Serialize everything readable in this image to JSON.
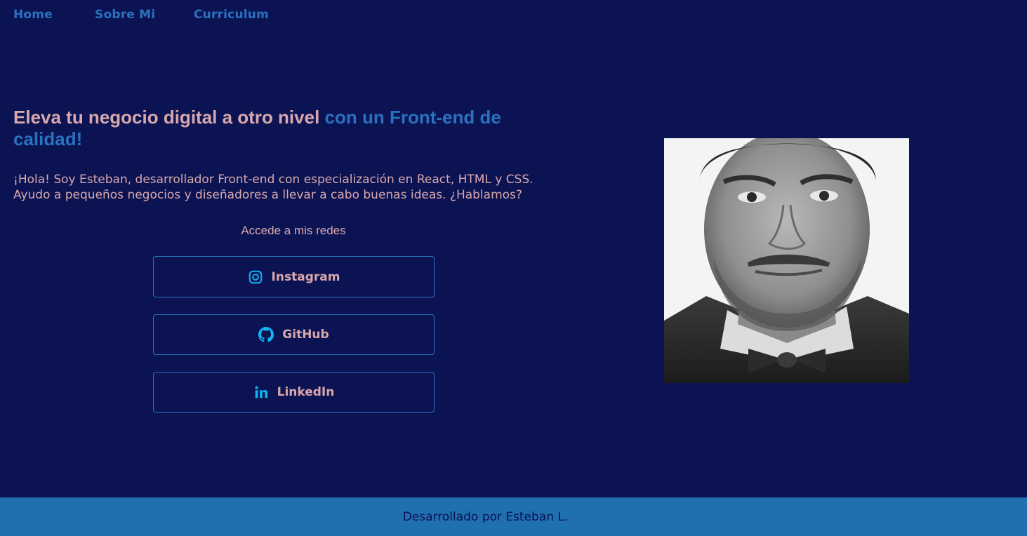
{
  "nav": {
    "items": [
      {
        "label": "Home"
      },
      {
        "label": "Sobre Mi"
      },
      {
        "label": "Curriculum"
      }
    ]
  },
  "hero": {
    "headline_part1": "Eleva tu negocio digital a otro nivel",
    "headline_part2": "con un Front-end de calidad!",
    "intro_line1": "¡Hola! Soy Esteban, desarrollador Front-end con especialización en React, HTML y CSS.",
    "intro_line2": "Ayudo a pequeños negocios y diseñadores a llevar a cabo buenas ideas. ¿Hablamos?",
    "socials_title": "Accede a mis redes",
    "socials": [
      {
        "label": "Instagram",
        "icon": "instagram-icon"
      },
      {
        "label": "GitHub",
        "icon": "github-icon"
      },
      {
        "label": "LinkedIn",
        "icon": "linkedin-icon"
      }
    ]
  },
  "profile_photo": {
    "icon": "portrait-photo"
  },
  "footer": {
    "text": "Desarrollado por Esteban L."
  },
  "colors": {
    "background": "#0b1353",
    "accent_blue": "#2a72c0",
    "text_pink": "#d9a8ac",
    "icon_cyan": "#11b4ee",
    "footer_bg": "#2070b0"
  }
}
